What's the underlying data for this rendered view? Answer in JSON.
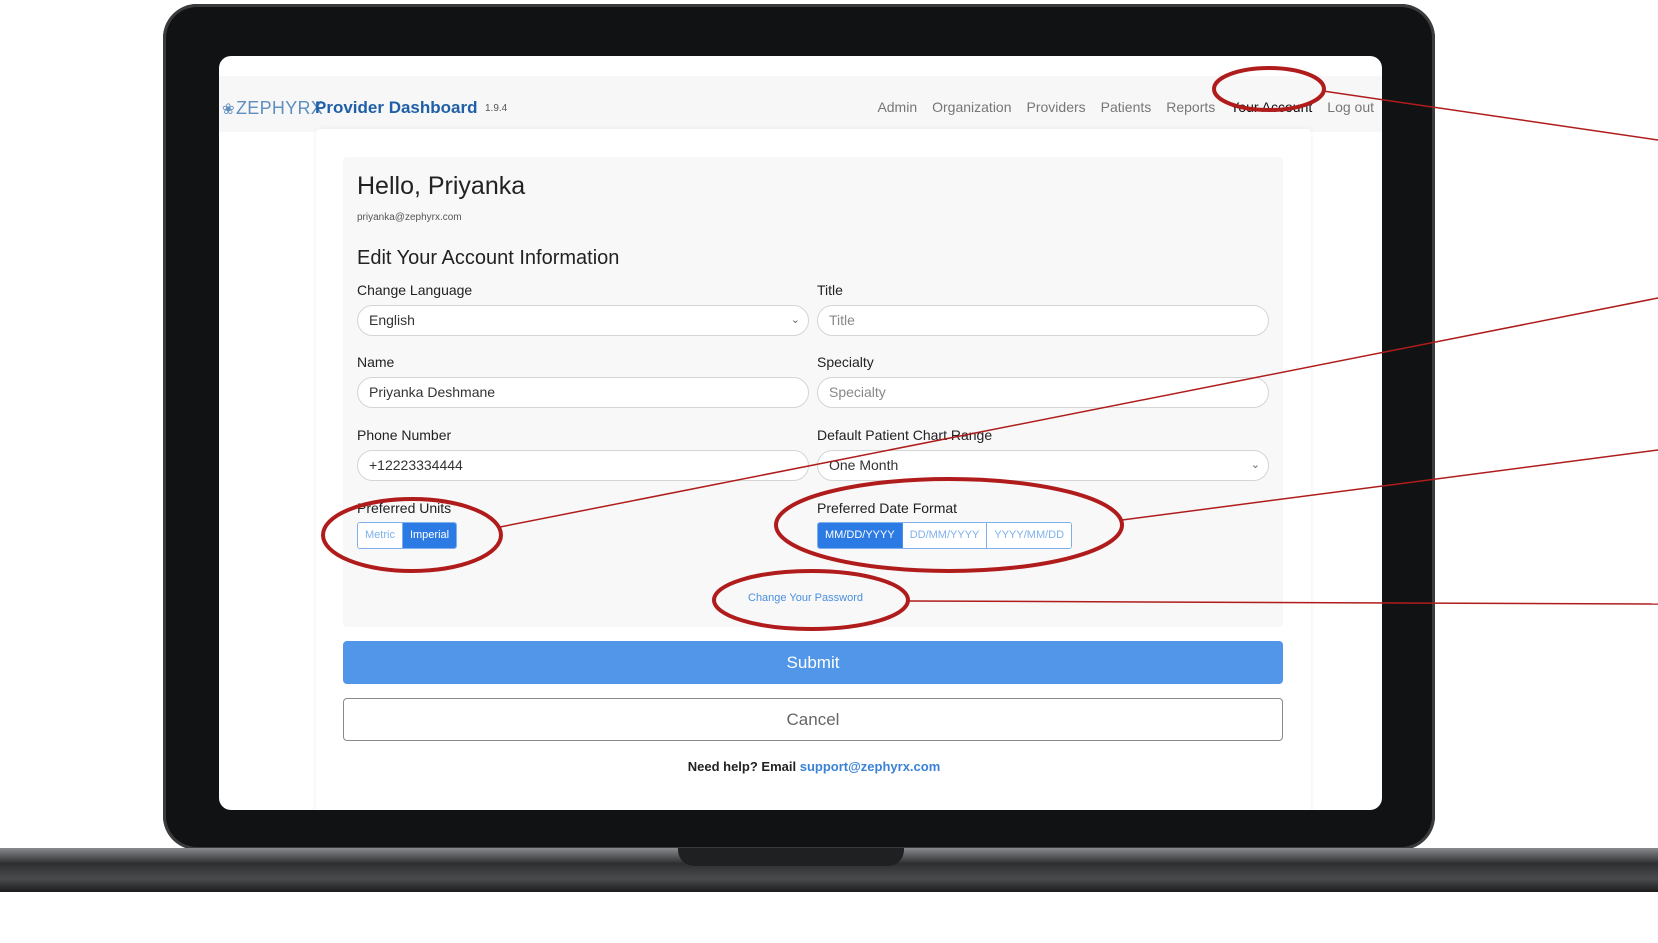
{
  "app": {
    "logo_text": "ZEPHYRX",
    "brand": "Provider Dashboard",
    "version": "1.9.4"
  },
  "nav": {
    "items": [
      "Admin",
      "Organization",
      "Providers",
      "Patients",
      "Reports",
      "Your Account",
      "Log out"
    ],
    "active": "Your Account"
  },
  "profile": {
    "greeting": "Hello, Priyanka",
    "email": "priyanka@zephyrx.com"
  },
  "form": {
    "heading": "Edit Your Account Information",
    "language": {
      "label": "Change Language",
      "value": "English"
    },
    "title": {
      "label": "Title",
      "placeholder": "Title"
    },
    "name": {
      "label": "Name",
      "value": "Priyanka Deshmane"
    },
    "specialty": {
      "label": "Specialty",
      "placeholder": "Specialty"
    },
    "phone": {
      "label": "Phone Number",
      "value": "+12223334444"
    },
    "chart_range": {
      "label": "Default Patient Chart Range",
      "value": "One Month"
    },
    "units": {
      "label": "Preferred Units",
      "options": [
        "Metric",
        "Imperial"
      ],
      "selected": "Imperial"
    },
    "date_format": {
      "label": "Preferred Date Format",
      "options": [
        "MM/DD/YYYY",
        "DD/MM/YYYY",
        "YYYY/MM/DD"
      ],
      "selected": "MM/DD/YYYY"
    },
    "change_password": "Change Your Password"
  },
  "actions": {
    "submit": "Submit",
    "cancel": "Cancel"
  },
  "help": {
    "text": "Need help? Email",
    "email": "support@zephyrx.com"
  },
  "colors": {
    "brand_blue": "#1f5fa8",
    "accent_blue": "#2c7be5",
    "submit_blue": "#5196e8",
    "annotation_red": "#b01c1c"
  }
}
